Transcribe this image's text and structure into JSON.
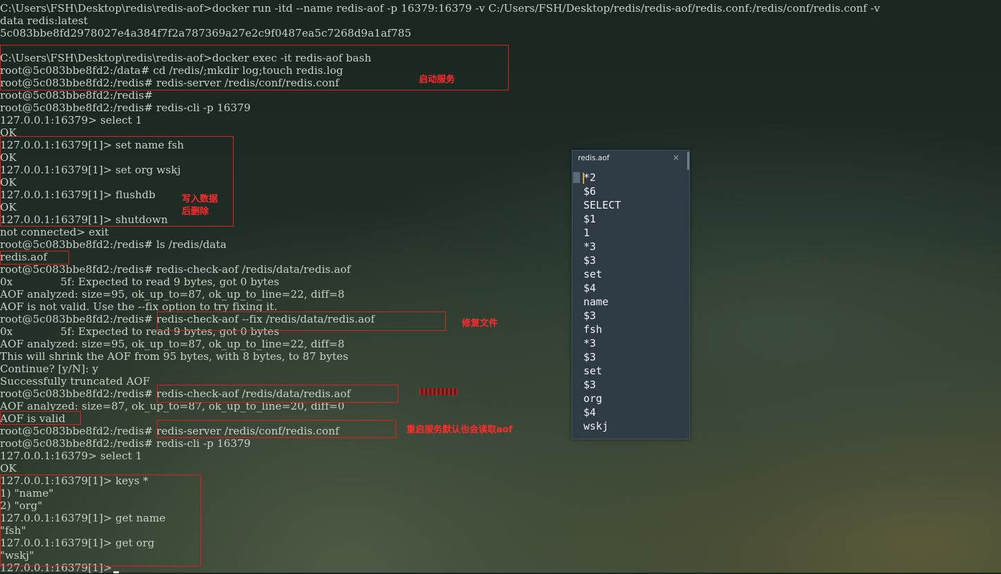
{
  "terminal": {
    "lines": [
      "C:\\Users\\FSH\\Desktop\\redis\\redis-aof>docker run -itd --name redis-aof -p 16379:16379 -v C:/Users/FSH/Desktop/redis/redis-aof/redis.conf:/redis/conf/redis.conf -v",
      "data redis:latest",
      "5c083bbe8fd2978027e4a384f7f2a787369a27e2c9f0487ea5c7268d9a1af785",
      "",
      "C:\\Users\\FSH\\Desktop\\redis\\redis-aof>docker exec -it redis-aof bash",
      "root@5c083bbe8fd2:/data# cd /redis/;mkdir log;touch redis.log",
      "root@5c083bbe8fd2:/redis# redis-server /redis/conf/redis.conf",
      "root@5c083bbe8fd2:/redis#",
      "root@5c083bbe8fd2:/redis# redis-cli -p 16379",
      "127.0.0.1:16379> select 1",
      "OK",
      "127.0.0.1:16379[1]> set name fsh",
      "OK",
      "127.0.0.1:16379[1]> set org wskj",
      "OK",
      "127.0.0.1:16379[1]> flushdb",
      "OK",
      "127.0.0.1:16379[1]> shutdown",
      "not connected> exit",
      "root@5c083bbe8fd2:/redis# ls /redis/data",
      "redis.aof",
      "root@5c083bbe8fd2:/redis# redis-check-aof /redis/data/redis.aof",
      "0x              5f: Expected to read 9 bytes, got 0 bytes",
      "AOF analyzed: size=95, ok_up_to=87, ok_up_to_line=22, diff=8",
      "AOF is not valid. Use the --fix option to try fixing it.",
      "root@5c083bbe8fd2:/redis# redis-check-aof --fix /redis/data/redis.aof",
      "0x              5f: Expected to read 9 bytes, got 0 bytes",
      "AOF analyzed: size=95, ok_up_to=87, ok_up_to_line=22, diff=8",
      "This will shrink the AOF from 95 bytes, with 8 bytes, to 87 bytes",
      "Continue? [y/N]: y",
      "Successfully truncated AOF",
      "root@5c083bbe8fd2:/redis# redis-check-aof /redis/data/redis.aof",
      "AOF analyzed: size=87, ok_up_to=87, ok_up_to_line=20, diff=0",
      "AOF is valid",
      "root@5c083bbe8fd2:/redis# redis-server /redis/conf/redis.conf",
      "root@5c083bbe8fd2:/redis# redis-cli -p 16379",
      "127.0.0.1:16379> select 1",
      "OK",
      "127.0.0.1:16379[1]> keys *",
      "1) \"name\"",
      "2) \"org\"",
      "127.0.0.1:16379[1]> get name",
      "\"fsh\"",
      "127.0.0.1:16379[1]> get org",
      "\"wskj\"",
      "127.0.0.1:16379[1]>"
    ]
  },
  "annotations": {
    "start_service": "启动服务",
    "write_then_delete_line1": "写入数据",
    "write_then_delete_line2": "后删除",
    "fix_file": "修复文件",
    "restart_reads_aof": "重启服务默认也会读取aof"
  },
  "popup": {
    "title": "redis.aof",
    "close": "×",
    "lines": [
      "*2",
      "$6",
      "SELECT",
      "$1",
      "1",
      "*3",
      "$3",
      "set",
      "$4",
      "name",
      "$3",
      "fsh",
      "*3",
      "$3",
      "set",
      "$3",
      "org",
      "$4",
      "wskj"
    ]
  },
  "colors": {
    "terminal_text": "#c9d2c9",
    "annotation_red": "#ff2b2b",
    "box_red": "#d8241e",
    "popup_bg": "#2e3a44"
  }
}
